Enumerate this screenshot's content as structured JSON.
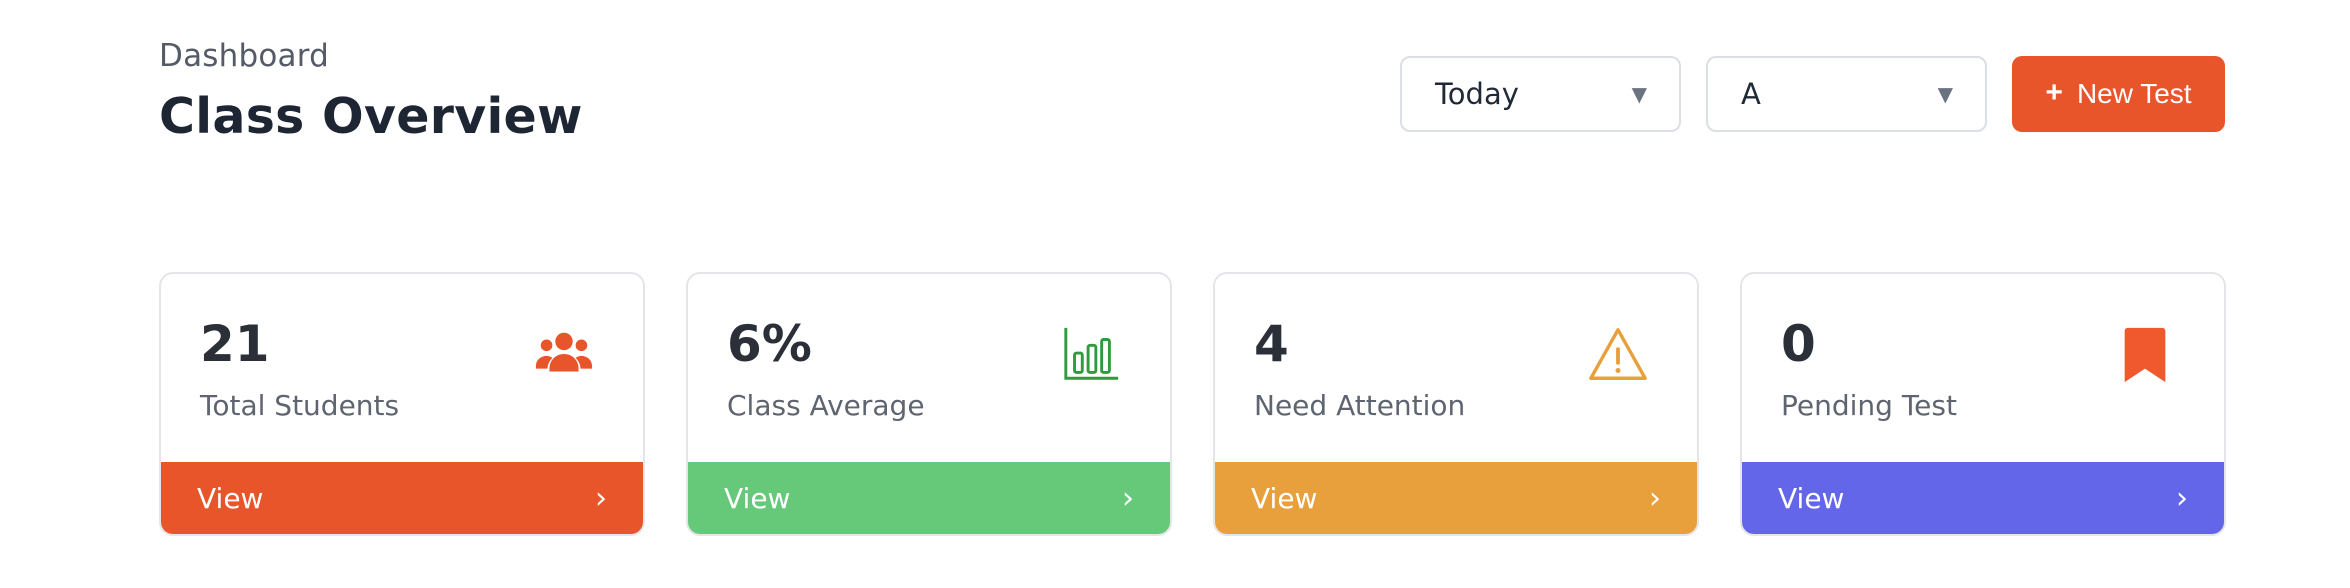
{
  "header": {
    "breadcrumb": "Dashboard",
    "title": "Class Overview"
  },
  "controls": {
    "period_select": "Today",
    "section_select": "A",
    "new_test_label": "New Test",
    "new_test_icon": "+",
    "caret": "▼"
  },
  "cards": [
    {
      "value": "21",
      "label": "Total Students",
      "footer": "View",
      "chevron": "›",
      "icon": "users-icon",
      "color": "#e8552a",
      "icon_color": "#e8552a"
    },
    {
      "value": "6%",
      "label": "Class Average",
      "footer": "View",
      "chevron": "›",
      "icon": "bar-chart-icon",
      "color": "#66c97a",
      "icon_color": "#2f9a3e"
    },
    {
      "value": "4",
      "label": "Need Attention",
      "footer": "View",
      "chevron": "›",
      "icon": "warning-icon",
      "color": "#e8a03c",
      "icon_color": "#e8a03c"
    },
    {
      "value": "0",
      "label": "Pending Test",
      "footer": "View",
      "chevron": "›",
      "icon": "bookmark-icon",
      "color": "#6466e9",
      "icon_color": "#f0582d"
    }
  ]
}
